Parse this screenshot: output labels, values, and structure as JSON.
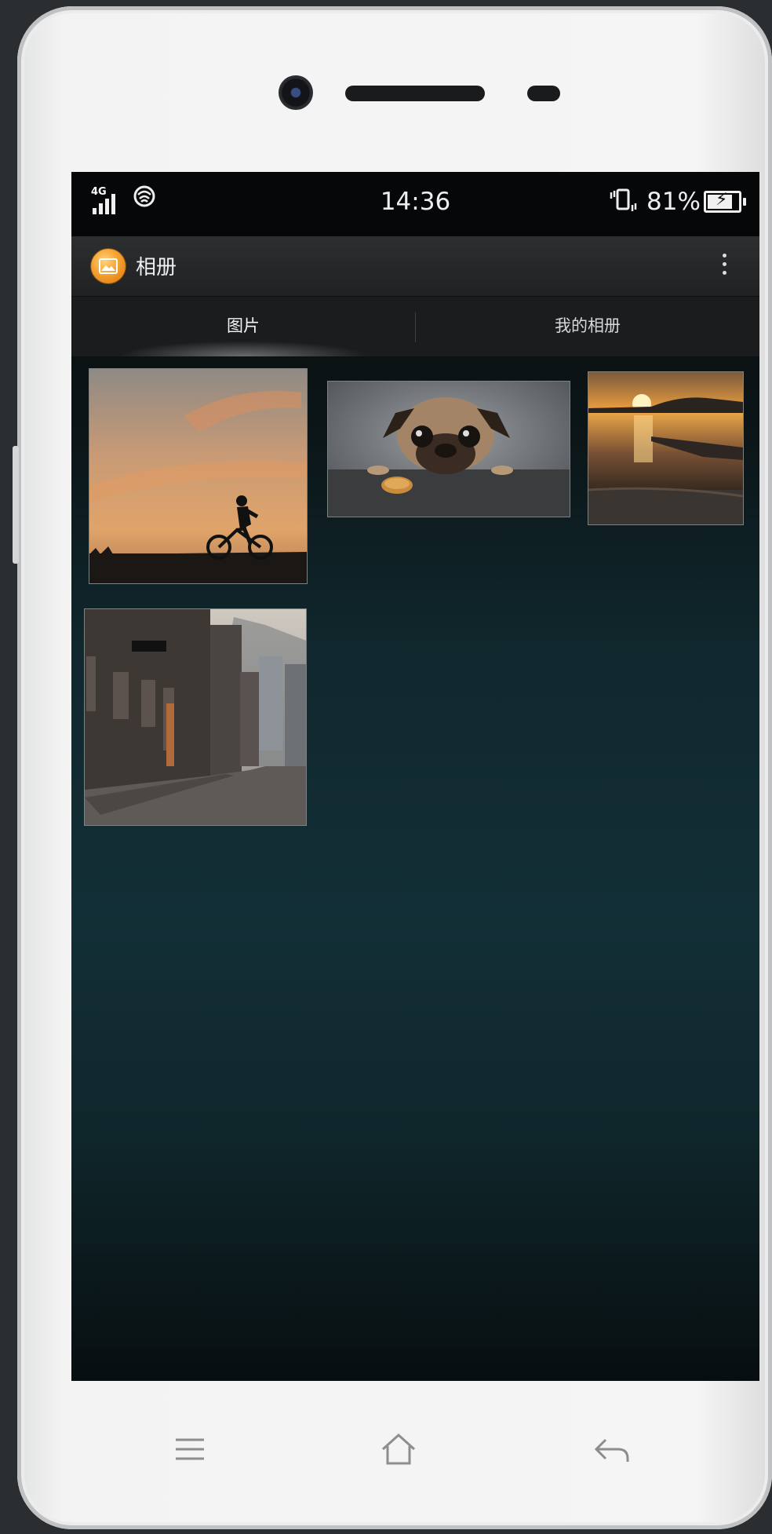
{
  "status_bar": {
    "network_type": "4G",
    "time": "14:36",
    "battery_percent": "81%",
    "battery_level": 0.81,
    "icons": [
      "signal-icon",
      "wifi-icon",
      "vibrate-icon",
      "battery-charging-icon"
    ]
  },
  "app_bar": {
    "title": "相册",
    "icon": "gallery-app-icon",
    "menu_icon": "more-vert-icon"
  },
  "tabs": [
    {
      "label": "图片",
      "active": true
    },
    {
      "label": "我的相册",
      "active": false
    }
  ],
  "photos": [
    {
      "subject": "cyclist at sunset"
    },
    {
      "subject": "pug with cookie"
    },
    {
      "subject": "lake pier sunset"
    },
    {
      "subject": "city alley street"
    }
  ],
  "nav_bar": {
    "icons": [
      "menu-icon",
      "home-icon",
      "back-icon"
    ]
  },
  "colors": {
    "screen_bg": "#132f36",
    "app_bar_bg": "#2c2e30",
    "accent_orange": "#f5a130"
  }
}
